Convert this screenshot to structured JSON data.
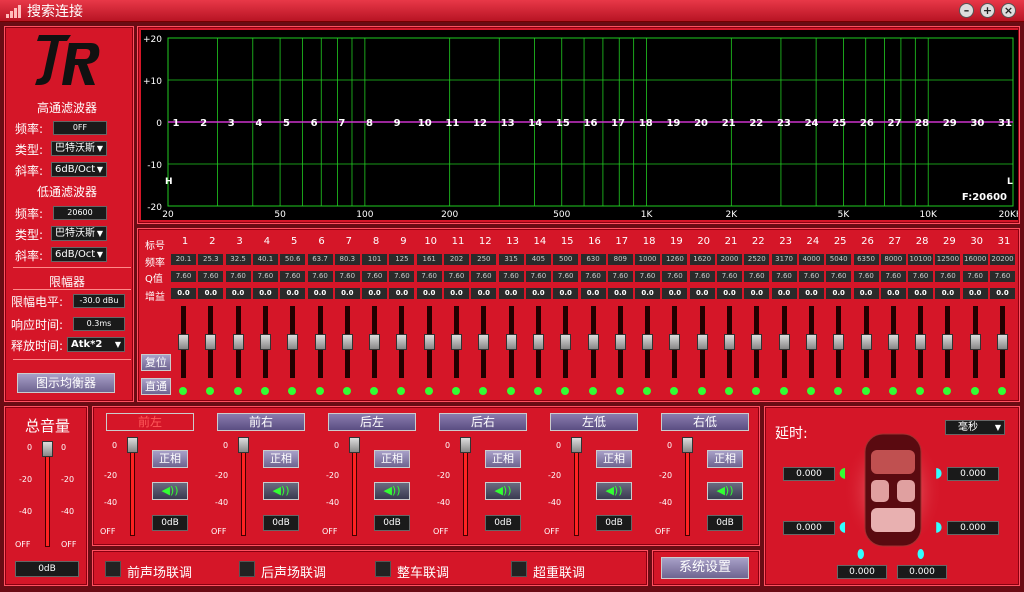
{
  "window": {
    "title": "搜索连接"
  },
  "left": {
    "highpass": {
      "title": "高通滤波器",
      "freq_label": "频率:",
      "freq_value": "0FF",
      "type_label": "类型:",
      "type_value": "巴特沃斯",
      "slope_label": "斜率:",
      "slope_value": "6dB/Oct"
    },
    "lowpass": {
      "title": "低通滤波器",
      "freq_label": "频率:",
      "freq_value": "20600",
      "type_label": "类型:",
      "type_value": "巴特沃斯",
      "slope_label": "斜率:",
      "slope_value": "6dB/Oct"
    },
    "limiter": {
      "title": "限幅器",
      "level_label": "限幅电平:",
      "level_value": "-30.0 dBu",
      "attack_label": "响应时间:",
      "attack_value": "0.3ms",
      "release_label": "释放时间:",
      "release_value": "Atk*2"
    },
    "graphic_eq_button": "图示均衡器"
  },
  "plot": {
    "y_labels": [
      "+20",
      "+10",
      "0",
      "-10",
      "-20"
    ],
    "x_labels": [
      "20",
      "50",
      "100",
      "200",
      "500",
      "1K",
      "2K",
      "5K",
      "10K",
      "20KHz"
    ],
    "band_markers": [
      "1",
      "2",
      "3",
      "4",
      "5",
      "6",
      "7",
      "8",
      "9",
      "10",
      "11",
      "12",
      "13",
      "14",
      "15",
      "16",
      "17",
      "18",
      "19",
      "20",
      "21",
      "22",
      "23",
      "24",
      "25",
      "26",
      "27",
      "28",
      "29",
      "30",
      "31"
    ],
    "h_label": "H",
    "l_label": "L",
    "f_readout": "F:20600"
  },
  "eq": {
    "row_labels": {
      "index": "标号",
      "freq": "频率",
      "q": "Q值",
      "gain": "增益"
    },
    "bands": [
      "1",
      "2",
      "3",
      "4",
      "5",
      "6",
      "7",
      "8",
      "9",
      "10",
      "11",
      "12",
      "13",
      "14",
      "15",
      "16",
      "17",
      "18",
      "19",
      "20",
      "21",
      "22",
      "23",
      "24",
      "25",
      "26",
      "27",
      "28",
      "29",
      "30",
      "31"
    ],
    "freqs": [
      "20.1",
      "25.3",
      "32.5",
      "40.1",
      "50.6",
      "63.7",
      "80.3",
      "101",
      "125",
      "161",
      "202",
      "250",
      "315",
      "405",
      "500",
      "630",
      "809",
      "1000",
      "1260",
      "1620",
      "2000",
      "2520",
      "3170",
      "4000",
      "5040",
      "6350",
      "8000",
      "10100",
      "12500",
      "16000",
      "20200"
    ],
    "q": "7.60",
    "gain": "0.0",
    "reset_button": "复位",
    "bypass_button": "直通"
  },
  "master": {
    "title": "总音量",
    "scale": [
      "0",
      "-20",
      "-40",
      "OFF"
    ],
    "value": "0dB"
  },
  "channels": [
    {
      "name": "前左",
      "phase": "正相",
      "value": "0dB"
    },
    {
      "name": "前右",
      "phase": "正相",
      "value": "0dB"
    },
    {
      "name": "后左",
      "phase": "正相",
      "value": "0dB"
    },
    {
      "name": "后右",
      "phase": "正相",
      "value": "0dB"
    },
    {
      "name": "左低",
      "phase": "正相",
      "value": "0dB"
    },
    {
      "name": "右低",
      "phase": "正相",
      "value": "0dB"
    }
  ],
  "channel_scale": [
    "0",
    "-20",
    "-40",
    "OFF"
  ],
  "links": {
    "front": "前声场联调",
    "rear": "后声场联调",
    "whole": "整车联调",
    "sub": "超重联调"
  },
  "system_settings": "系统设置",
  "delay": {
    "title": "延时:",
    "unit": "毫秒",
    "values": [
      "0.000",
      "0.000",
      "0.000",
      "0.000",
      "0.000",
      "0.000"
    ]
  }
}
